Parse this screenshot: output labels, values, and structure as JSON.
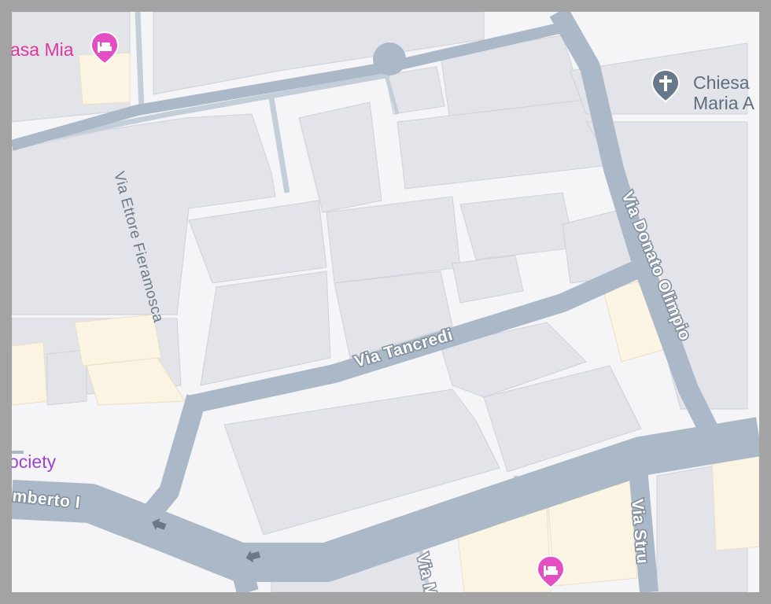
{
  "colors": {
    "hotel_pin": "#e34ec3",
    "church_pin": "#66788a",
    "hotel_label": "#e0359b",
    "society_label": "#9a45d6",
    "church_label": "#5e6e7e",
    "road": "#aab8c8",
    "building": "#e3e4ea",
    "highlight_building": "#fbf4e3"
  },
  "streets": {
    "via_tancredi": "Via Tancredi",
    "via_donato_olimpio": "Via Donato Olimpio",
    "via_ettore_fieramosca": "Via Ettore Fieramosca",
    "umberto": "mberto I",
    "via_stru": "Via Stru",
    "via_m": "Via M"
  },
  "pois": {
    "casa_mia": {
      "label": "asa Mia",
      "icon": "hotel-bed-icon"
    },
    "chiesa": {
      "label_line1": "Chiesa",
      "label_line2": "Maria A",
      "icon": "church-cross-icon"
    },
    "society": {
      "label": "ociety"
    },
    "hotel_bottom": {
      "icon": "hotel-bed-icon"
    }
  }
}
